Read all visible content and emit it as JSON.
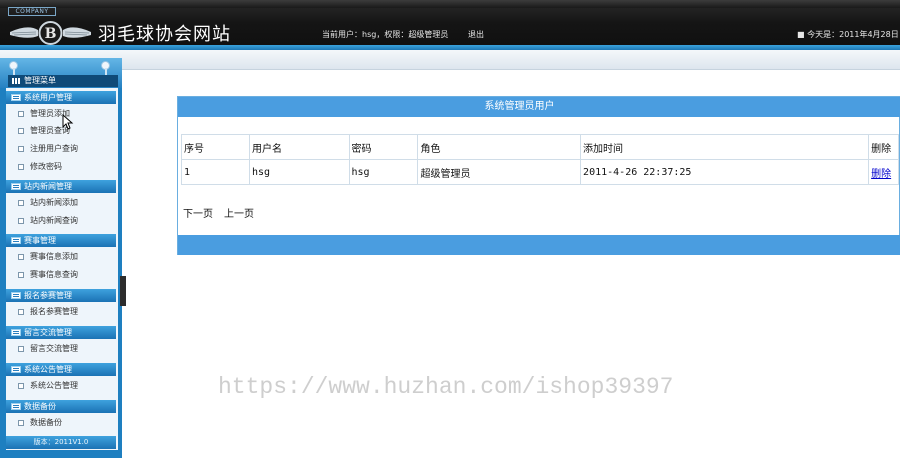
{
  "header": {
    "company_badge": "COMPANY",
    "site_title": "羽毛球协会网站",
    "user_info": "当前用户：hsg，权限：超级管理员",
    "logout_label": "退出",
    "today": "■ 今天是：2011年4月28日"
  },
  "sidebar": {
    "menu_title": "管理菜单",
    "groups": [
      {
        "title": "系统用户管理",
        "items": [
          "管理员添加",
          "管理员查询",
          "注册用户查询",
          "修改密码"
        ]
      },
      {
        "title": "站内新闻管理",
        "items": [
          "站内新闻添加",
          "站内新闻查询"
        ]
      },
      {
        "title": "赛事管理",
        "items": [
          "赛事信息添加",
          "赛事信息查询"
        ]
      },
      {
        "title": "报名参赛管理",
        "items": [
          "报名参赛管理"
        ]
      },
      {
        "title": "留言交流管理",
        "items": [
          "留言交流管理"
        ]
      },
      {
        "title": "系统公告管理",
        "items": [
          "系统公告管理"
        ]
      },
      {
        "title": "数据备份",
        "items": [
          "数据备份"
        ]
      }
    ],
    "version": "版本：2011V1.0"
  },
  "panel": {
    "title": "系统管理员用户",
    "columns": [
      "序号",
      "用户名",
      "密码",
      "角色",
      "添加时间",
      "删除"
    ],
    "rows": [
      {
        "id": "1",
        "username": "hsg",
        "password": "hsg",
        "role": "超级管理员",
        "added": "2011-4-26 22:37:25",
        "action": "删除"
      }
    ],
    "pager": {
      "next": "下一页",
      "prev": "上一页"
    }
  },
  "watermark": "https://www.huzhan.com/ishop39397",
  "colors": {
    "accent": "#4a9de0",
    "sidebar": "#1e7fc0",
    "header": "#151515"
  }
}
